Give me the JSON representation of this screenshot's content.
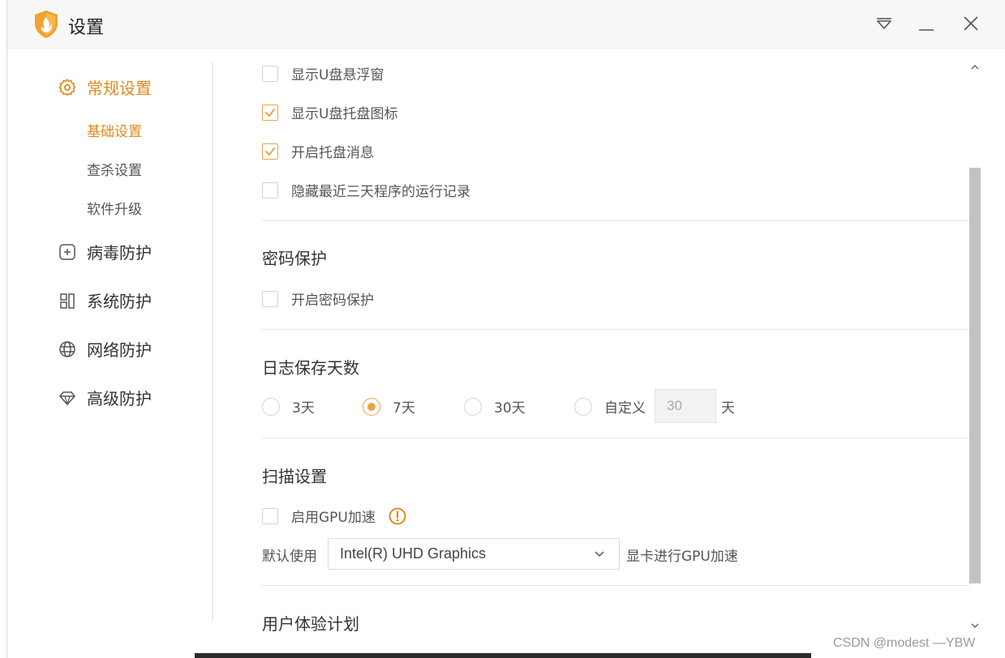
{
  "window": {
    "title": "设置"
  },
  "sidebar": {
    "general": {
      "label": "常规设置",
      "icon": "gear-icon"
    },
    "sub_items": [
      {
        "label": "基础设置",
        "active": true
      },
      {
        "label": "查杀设置",
        "active": false
      },
      {
        "label": "软件升级",
        "active": false
      }
    ],
    "items": [
      {
        "label": "病毒防护",
        "icon": "plus-square-icon"
      },
      {
        "label": "系统防护",
        "icon": "grid-icon"
      },
      {
        "label": "网络防护",
        "icon": "globe-icon"
      },
      {
        "label": "高级防护",
        "icon": "diamond-icon"
      }
    ]
  },
  "basic": {
    "options": [
      {
        "label": "显示U盘悬浮窗",
        "checked": false
      },
      {
        "label": "显示U盘托盘图标",
        "checked": true
      },
      {
        "label": "开启托盘消息",
        "checked": true
      },
      {
        "label": "隐藏最近三天程序的运行记录",
        "checked": false
      }
    ]
  },
  "password": {
    "title": "密码保护",
    "option_label": "开启密码保护",
    "checked": false
  },
  "log_days": {
    "title": "日志保存天数",
    "options": [
      "3天",
      "7天",
      "30天",
      "自定义"
    ],
    "selected": "7天",
    "custom_value": "30",
    "unit": "天"
  },
  "scan": {
    "title": "扫描设置",
    "gpu_label": "启用GPU加速",
    "gpu_checked": false,
    "default_prefix": "默认使用",
    "gpu_device": "Intel(R) UHD Graphics",
    "default_suffix": "显卡进行GPU加速"
  },
  "ux": {
    "title": "用户体验计划"
  },
  "watermark": "CSDN @modest —YBW",
  "colors": {
    "accent": "#e9a34a",
    "accent_text": "#e08a1e"
  }
}
